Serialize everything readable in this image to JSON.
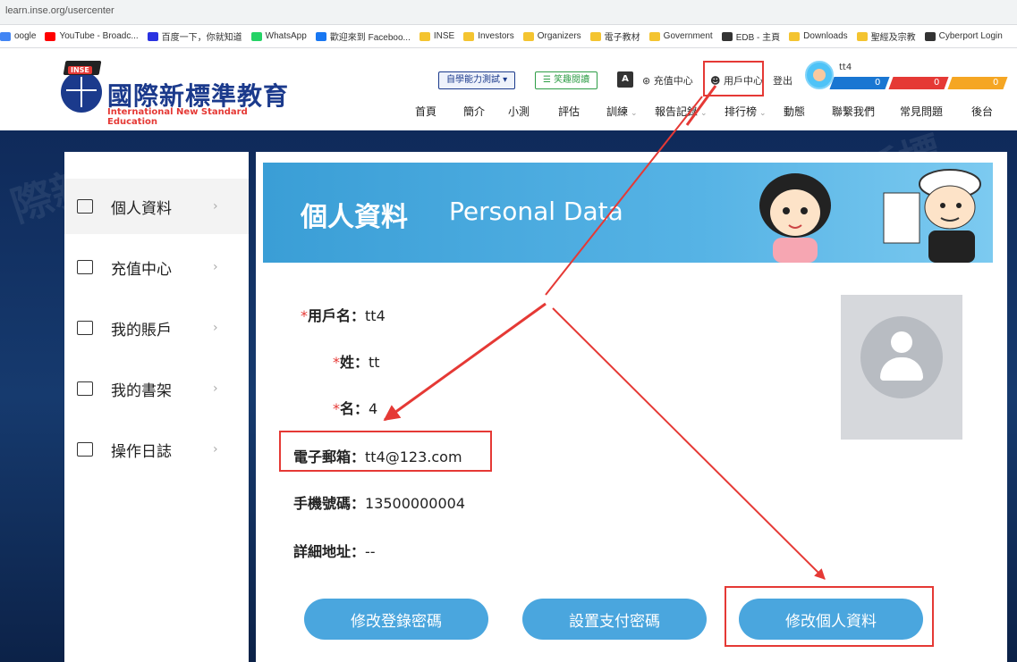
{
  "browser": {
    "url": "learn.inse.org/usercenter"
  },
  "bookmarks": [
    {
      "label": "oogle",
      "color": "#4285f4"
    },
    {
      "label": "YouTube - Broadc...",
      "color": "#ff0000"
    },
    {
      "label": "百度一下，你就知道",
      "color": "#2932e1"
    },
    {
      "label": "WhatsApp",
      "color": "#25d366"
    },
    {
      "label": "歡迎來到 Faceboo...",
      "color": "#1877f2"
    },
    {
      "label": "INSE",
      "color": "#f4c430"
    },
    {
      "label": "Investors",
      "color": "#f4c430"
    },
    {
      "label": "Organizers",
      "color": "#f4c430"
    },
    {
      "label": "電子教材",
      "color": "#f4c430"
    },
    {
      "label": "Government",
      "color": "#f4c430"
    },
    {
      "label": "EDB - 主頁",
      "color": "#333333"
    },
    {
      "label": "Downloads",
      "color": "#f4c430"
    },
    {
      "label": "聖經及宗教",
      "color": "#f4c430"
    },
    {
      "label": "Cyberport Login",
      "color": "#333333"
    }
  ],
  "logo": {
    "badge": "INSE",
    "cn": "國際新標準教育",
    "en": "International New Standard Education"
  },
  "header": {
    "self_test": "自學能力測試 ▾",
    "read": "☰ 笑趣閱讀",
    "font_icon": "A",
    "recharge": "充值中心",
    "user_center": "用戶中心",
    "logout": "登出",
    "username": "tt4",
    "stats": [
      {
        "value": "0",
        "color": "#1976d2"
      },
      {
        "value": "0",
        "color": "#e53935"
      },
      {
        "value": "0",
        "color": "#f5a623"
      }
    ]
  },
  "nav": [
    {
      "label": "首頁",
      "chev": ""
    },
    {
      "label": "簡介",
      "chev": ""
    },
    {
      "label": "小測",
      "chev": ""
    },
    {
      "label": "評估",
      "chev": ""
    },
    {
      "label": "訓練",
      "chev": "⌄"
    },
    {
      "label": "報告記錄",
      "chev": "⌄"
    },
    {
      "label": "排行榜",
      "chev": "⌄"
    },
    {
      "label": "動態",
      "chev": ""
    },
    {
      "label": "聯繫我們",
      "chev": ""
    },
    {
      "label": "常見問題",
      "chev": ""
    },
    {
      "label": "後台",
      "chev": ""
    }
  ],
  "sidebar": [
    {
      "label": "個人資料",
      "icon": "id-card-icon"
    },
    {
      "label": "充值中心",
      "icon": "coin-icon"
    },
    {
      "label": "我的賬戶",
      "icon": "wallet-icon"
    },
    {
      "label": "我的書架",
      "icon": "bookshelf-icon"
    },
    {
      "label": "操作日誌",
      "icon": "calendar-icon"
    }
  ],
  "banner": {
    "title": "個人資料",
    "subtitle": "Personal Data"
  },
  "fields": {
    "username": {
      "label": "用戶名：",
      "value": "tt4"
    },
    "surname": {
      "label": "姓：",
      "value": "tt"
    },
    "given": {
      "label": "名：",
      "value": "4"
    },
    "email": {
      "label": "電子郵箱：",
      "value": "tt4@123.com"
    },
    "phone": {
      "label": "手機號碼：",
      "value": "13500000004"
    },
    "address": {
      "label": "詳細地址：",
      "value": "--"
    }
  },
  "buttons": {
    "change_login_pw": "修改登錄密碼",
    "set_pay_pw": "設置支付密碼",
    "edit_profile": "修改個人資料"
  },
  "annotation_color": "#e53935"
}
